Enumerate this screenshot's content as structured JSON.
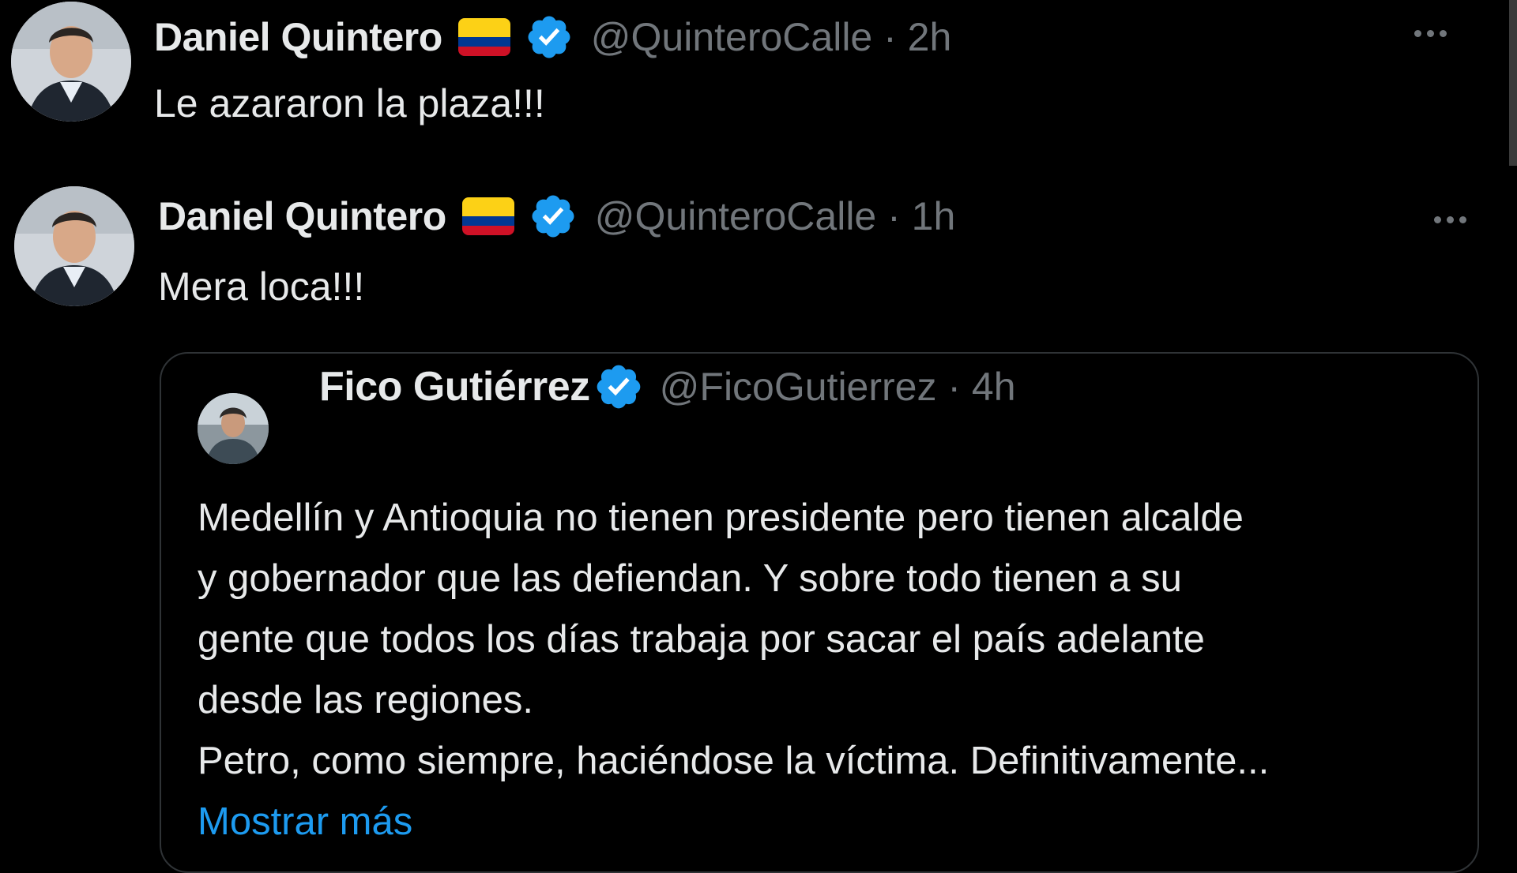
{
  "tweets": [
    {
      "author_name": "Daniel Quintero",
      "handle_time": "@QuinteroCalle · 2h",
      "text": "Le azararon la plaza!!!"
    },
    {
      "author_name": "Daniel Quintero",
      "handle_time": "@QuinteroCalle · 1h",
      "text": "Mera loca!!!",
      "quote": {
        "author_name": "Fico Gutiérrez",
        "handle_time": "@FicoGutierrez · 4h",
        "lines": [
          "Medellín y Antioquia no tienen presidente pero tienen alcalde",
          "y gobernador que las defiendan. Y sobre todo tienen a su",
          "gente que todos los días trabaja por sacar el país adelante",
          "desde las regiones.",
          "Petro, como siempre, haciéndose la víctima. Definitivamente..."
        ],
        "show_more": "Mostrar más"
      }
    }
  ],
  "icons": {
    "flag": "colombia-flag-icon",
    "verified": "verified-badge-icon",
    "more": "more-options-icon"
  },
  "colors": {
    "background": "#000000",
    "text_primary": "#e7e9ea",
    "text_secondary": "#71767b",
    "link": "#1d9bf0",
    "verified": "#1d9bf0",
    "border": "#2f3336"
  }
}
